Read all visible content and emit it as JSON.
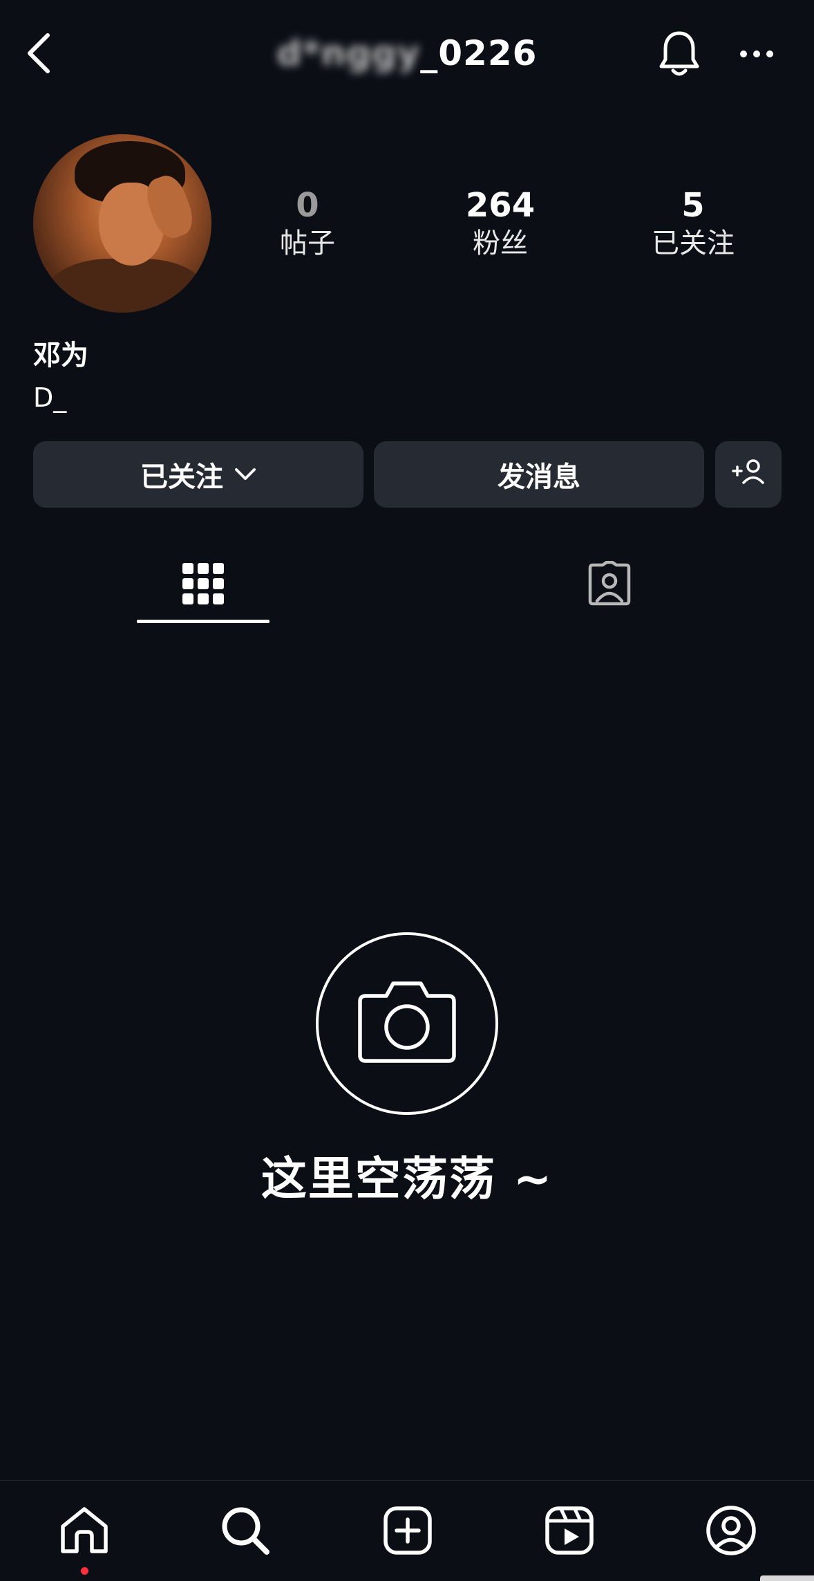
{
  "header": {
    "username_hidden": "d*nggy",
    "username_visible": "_0226",
    "icons": {
      "back": "chevron-left-icon",
      "notifications": "bell-icon",
      "more": "more-horizontal-icon"
    }
  },
  "profile": {
    "stats": [
      {
        "value": "0",
        "label": "帖子"
      },
      {
        "value": "264",
        "label": "粉丝"
      },
      {
        "value": "5",
        "label": "已关注"
      }
    ],
    "display_name": "邓为",
    "bio": "D_"
  },
  "actions": {
    "following_label": "已关注",
    "message_label": "发消息"
  },
  "empty_state": {
    "text": "这里空荡荡 ~"
  },
  "bottom_nav": {
    "items": [
      "home-icon",
      "search-icon",
      "create-icon",
      "reels-icon",
      "profile-icon"
    ],
    "notification_color": "#ff3040"
  },
  "theme": {
    "background": "#0b0e14",
    "button_bg": "#262a33",
    "text": "#ffffff"
  }
}
